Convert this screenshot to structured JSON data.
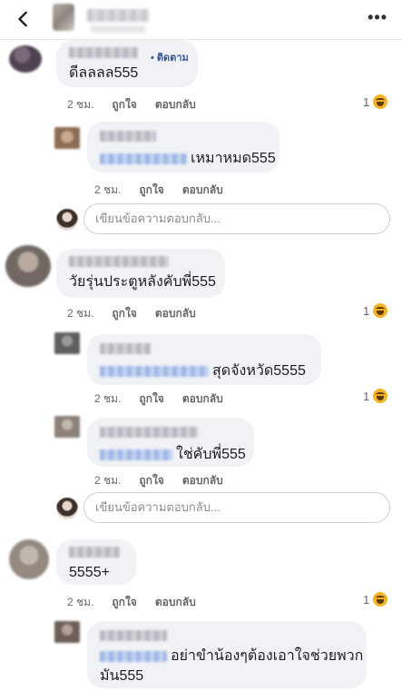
{
  "header": {
    "back_icon": "back-arrow-icon",
    "more_label": "•••"
  },
  "comments": [
    {
      "text": "ดีลลลล555",
      "follow": "• ติดตาม",
      "time": "2 ชม.",
      "like": "ถูกใจ",
      "reply": "ตอบกลับ",
      "react_count": "1",
      "replies": [
        {
          "text": "เหมาหมด555",
          "time": "2 ชม.",
          "like": "ถูกใจ",
          "reply": "ตอบกลับ"
        }
      ]
    },
    {
      "text": "วัยรุ่นประตูหลังคับพี่555",
      "time": "2 ชม.",
      "like": "ถูกใจ",
      "reply": "ตอบกลับ",
      "react_count": "1",
      "replies": [
        {
          "text": "สุดจังหวัด5555",
          "time": "2 ชม.",
          "like": "ถูกใจ",
          "reply": "ตอบกลับ",
          "react_count": "1"
        },
        {
          "text": "ใช่คับพี่555",
          "time": "2 ชม.",
          "like": "ถูกใจ",
          "reply": "ตอบกลับ"
        }
      ]
    },
    {
      "text": "5555+",
      "time": "2 ชม.",
      "like": "ถูกใจ",
      "reply": "ตอบกลับ",
      "react_count": "1",
      "replies": [
        {
          "text_line1": "อย่าขำน้องๆต้องเอาใจช่วยพวก",
          "text_line2": "มัน555"
        }
      ]
    }
  ],
  "reply_placeholder": "เขียนข้อความตอบกลับ...",
  "colors": {
    "bubble": "#f0f2f5",
    "meta": "#65676b",
    "link": "#385898",
    "haha": "#f7b125"
  }
}
